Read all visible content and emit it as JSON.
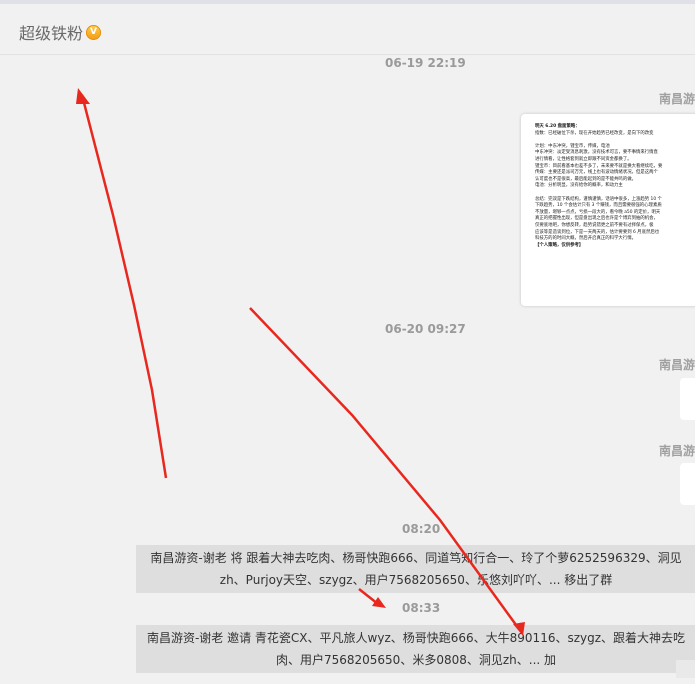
{
  "header": {
    "title": "超级铁粉",
    "badge_glyph": "V"
  },
  "messages": {
    "ts1": "06-19 22:19",
    "sender1": "南昌游",
    "ts2": "06-20 09:27",
    "sender2": "南昌游",
    "sender3": "南昌游",
    "ts3": "08:20",
    "ts4": "08:33",
    "sys1_line1": "南昌游资-谢老 将 跟着大神去吃肉、杨哥快跑666、同道笃知行合一、玲了个萝6252596329、洞见",
    "sys1_line2": "zh、Purjoy天空、szygz、用户7568205650、乐悠刘吖吖、... 移出了群",
    "sys2_line1": "南昌游资-谢老 邀请 青花瓷CX、平凡旅人wyz、杨哥快跑666、大牛890116、szygz、跟着大神去吃",
    "sys2_line2": "肉、用户7568205650、米多0808、洞见zh、... 加"
  },
  "image_card": {
    "heading": "明天 6.20 盘面策略：",
    "lines": [
      "指数：已经破位下杀，现在开始趋势已经改变，是向下的改变",
      "",
      "计划：中东冲突，锂宝币，传媒，电池",
      "中东冲突：淡定受消息刺激，没有技术可言，要不事情来行情直",
      "进行情看，让性格套到就立即跟不同资金都换了。",
      "锂宝币：目前看基本也差不多了，未来要不就是换大看继续吃，要",
      "传媒：主要还是派司万元，线上也有波动情绪状况，但是这两个",
      "认可度也不是很高，最后能起到的是不能共鸣的做。",
      "电池：分析明显，没有给你的概率，和动力主",
      "",
      "总结：完双是下跌结构，谨慎谨慎，话语中很多，上涨趋势 10 个",
      "下跌趋势，10 个会估计只有 3 个赚钱，而且需要很强的心理素质",
      "不放量，堪够一点点，亏损一段大的，看今晚 a50 的定价，明天",
      "真正的把握性出现，但是盘出现之后也许是个博弈到抽的机会，",
      "仅要底地吧，你想反转，趋势说错更之前不要有过择保点，极",
      "应该等是造谈到位，下是一天两天的，估计要要到 6 月底然后也",
      "科技方的的时间大概，然后开启真正的科学大行情。"
    ],
    "footer": "【个人策略，仅供参考】"
  }
}
